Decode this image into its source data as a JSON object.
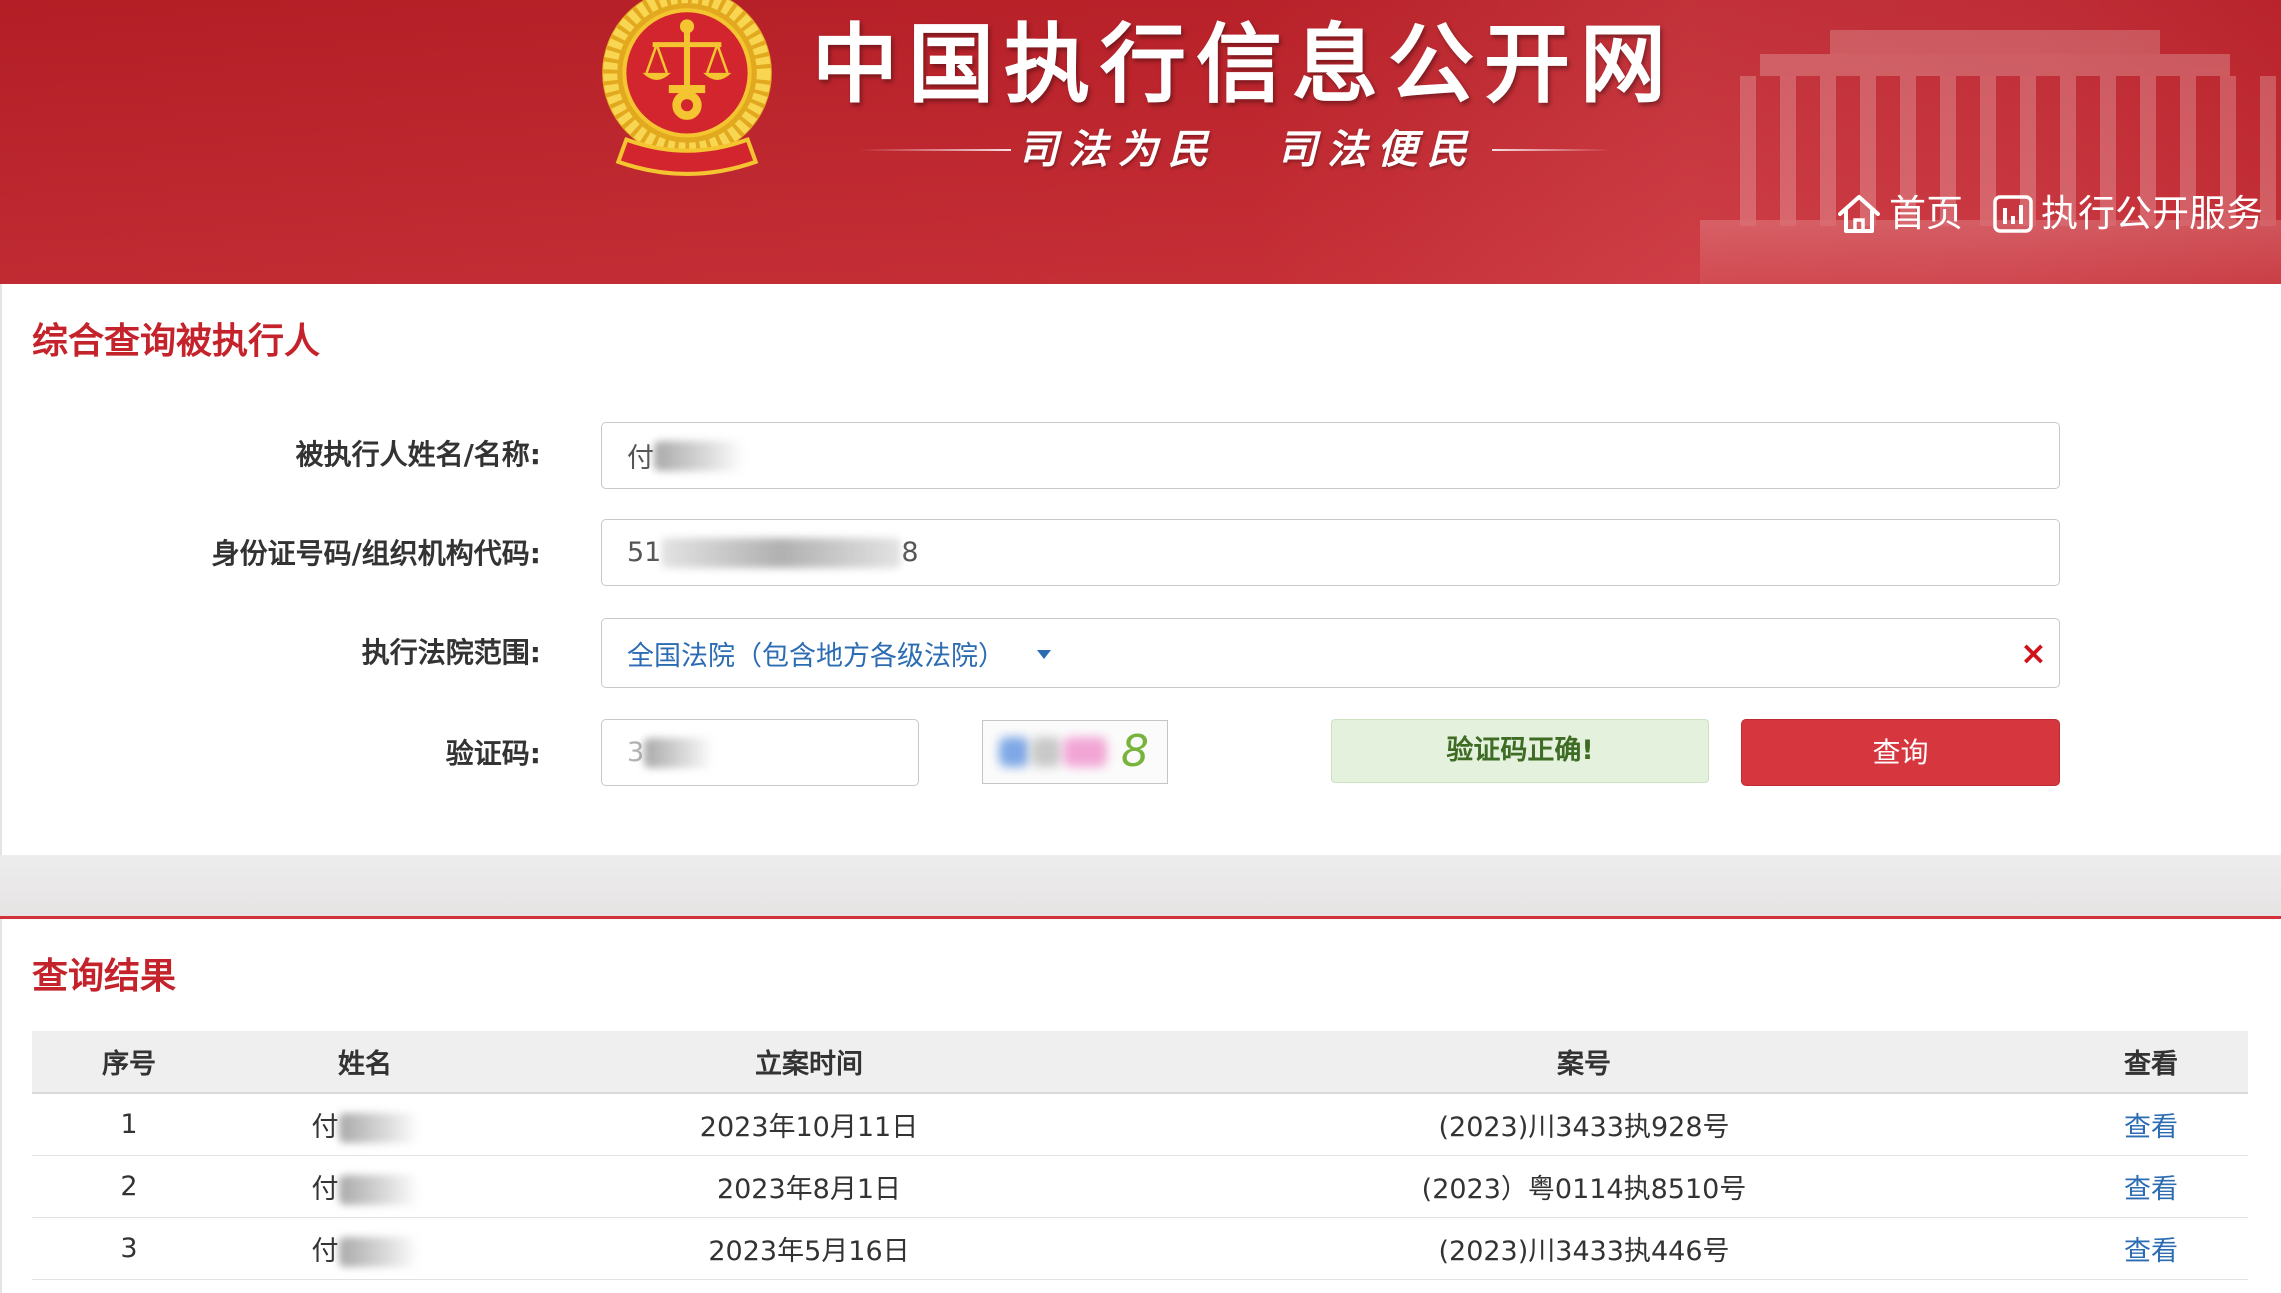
{
  "theme": {
    "brand_red": "#c4232b",
    "link_blue": "#2b6cb3",
    "button_red": "#d6363d",
    "success_bg": "#e4f1dc",
    "success_text": "#3e6c25"
  },
  "header": {
    "title": "中国执行信息公开网",
    "slogan_left": "司法为民",
    "slogan_right": "司法便民",
    "nav": [
      {
        "label": "首页",
        "icon": "home-icon"
      },
      {
        "label": "执行公开服务",
        "icon": "chart-icon"
      }
    ]
  },
  "search": {
    "title": "综合查询被执行人",
    "name_label": "被执行人姓名/名称:",
    "name_value": "付",
    "id_label": "身份证号码/组织机构代码:",
    "id_value_prefix": "51",
    "id_value_suffix": "8",
    "court_label": "执行法院范围:",
    "court_value": "全国法院（包含地方各级法院）",
    "dropdown_icon": "caret-down-icon",
    "clear_icon": "close-icon",
    "clear_glyph": "×",
    "captcha_label": "验证码:",
    "captcha_value": "3",
    "captcha_image_char": "8",
    "captcha_status": "验证码正确!",
    "submit_label": "查询"
  },
  "results": {
    "title": "查询结果",
    "columns": [
      "序号",
      "姓名",
      "立案时间",
      "案号",
      "查看"
    ],
    "rows": [
      {
        "index": "1",
        "name": "付",
        "date": "2023年10月11日",
        "case_no": "(2023)川3433执928号",
        "action": "查看"
      },
      {
        "index": "2",
        "name": "付",
        "date": "2023年8月1日",
        "case_no": "(2023）粤0114执8510号",
        "action": "查看"
      },
      {
        "index": "3",
        "name": "付",
        "date": "2023年5月16日",
        "case_no": "(2023)川3433执446号",
        "action": "查看"
      }
    ]
  }
}
